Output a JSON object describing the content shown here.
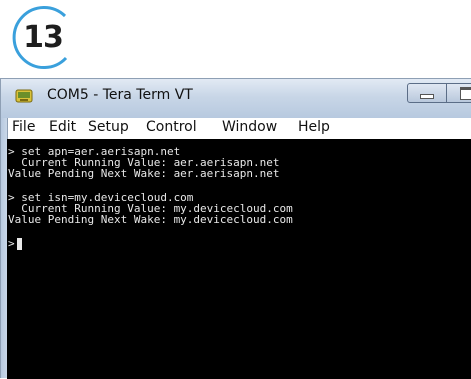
{
  "step": {
    "number": "13"
  },
  "window": {
    "title": "COM5 - Tera Term VT",
    "menu": [
      "File",
      "Edit",
      "Setup",
      "Control",
      "Window",
      "Help"
    ]
  },
  "terminal": {
    "lines": [
      "> set apn=aer.aerisapn.net",
      "  Current Running Value: aer.aerisapn.net",
      "Value Pending Next Wake: aer.aerisapn.net",
      "",
      "> set isn=my.devicecloud.com",
      "  Current Running Value: my.devicecloud.com",
      "Value Pending Next Wake: my.devicecloud.com",
      "",
      ">"
    ],
    "text_color": "#e8e8e8",
    "background": "#000000"
  },
  "icons": {
    "app": "tera-term-app-icon",
    "minimize": "minimize-icon",
    "maximize": "maximize-icon"
  }
}
